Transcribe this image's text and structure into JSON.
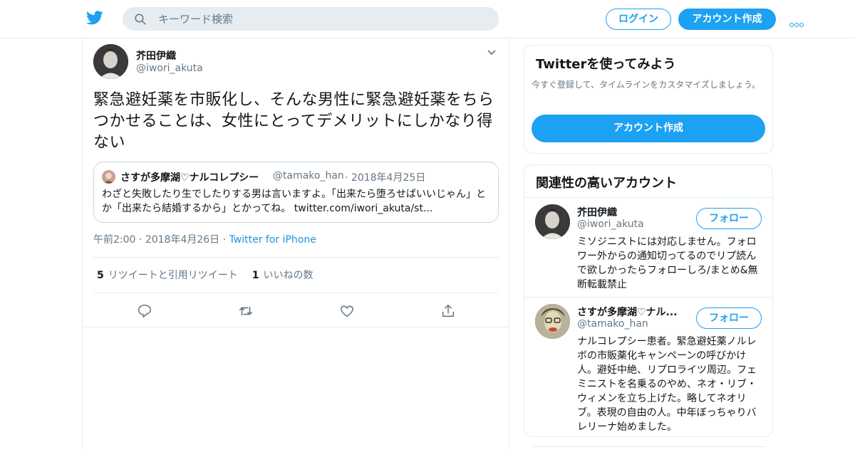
{
  "header": {
    "search_placeholder": "キーワード検索",
    "login_label": "ログイン",
    "signup_label": "アカウント作成"
  },
  "tweet": {
    "author_name": "芥田伊織",
    "author_handle": "@iwori_akuta",
    "text": "緊急避妊薬を市販化し、そんな男性に緊急避妊薬をちらつかせることは、女性にとってデメリットにしかなり得ない",
    "quote": {
      "name": "さすが多摩湖♡ナルコレプシー",
      "handle": "@tamako_han",
      "date": "2018年4月25日",
      "text": "わざと失敗したり生でしたりする男は言いますよ。「出来たら堕ろせばいいじゃん」とか「出来たら結婚するから」とかってね。 twitter.com/iwori_akuta/st..."
    },
    "time": "午前2:00",
    "date": "2018年4月26日",
    "source": "Twitter for iPhone",
    "retweets_count": "5",
    "retweets_label": "リツイートと引用リツイート",
    "likes_count": "1",
    "likes_label": "いいねの数"
  },
  "sidebar": {
    "promo": {
      "title": "Twitterを使ってみよう",
      "description": "今すぐ登録して、タイムラインをカスタマイズしましょう。",
      "button_label": "アカウント作成"
    },
    "related": {
      "title": "関連性の高いアカウント",
      "accounts": [
        {
          "name": "芥田伊織",
          "handle": "@iwori_akuta",
          "bio": "ミソジニストには対応しません。フォロワー外からの通知切ってるのでリプ読んで欲しかったらフォローしろ/まとめ&無断転載禁止",
          "follow_label": "フォロー"
        },
        {
          "name": "さすが多摩湖♡ナル...",
          "handle": "@tamako_han",
          "bio": "ナルコレプシー患者。緊急避妊薬ノルレボの市販薬化キャンペーンの呼びかけ人。避妊中絶、リプロライツ周辺。フェミニストを名乗るのやめ、ネオ・リブ・ウィメンを立ち上げた。略してネオリブ。表現の自由の人。中年ぼっちゃりバレリーナ始めました。",
          "follow_label": "フォロー"
        }
      ]
    }
  },
  "colors": {
    "brand": "#1da1f2",
    "text_primary": "#14171a",
    "text_secondary": "#657786",
    "border": "#e6ecf0"
  },
  "icons": [
    "twitter-bird-icon",
    "search-icon",
    "more-icon",
    "chevron-down-icon",
    "reply-icon",
    "retweet-icon",
    "like-icon",
    "share-icon"
  ]
}
